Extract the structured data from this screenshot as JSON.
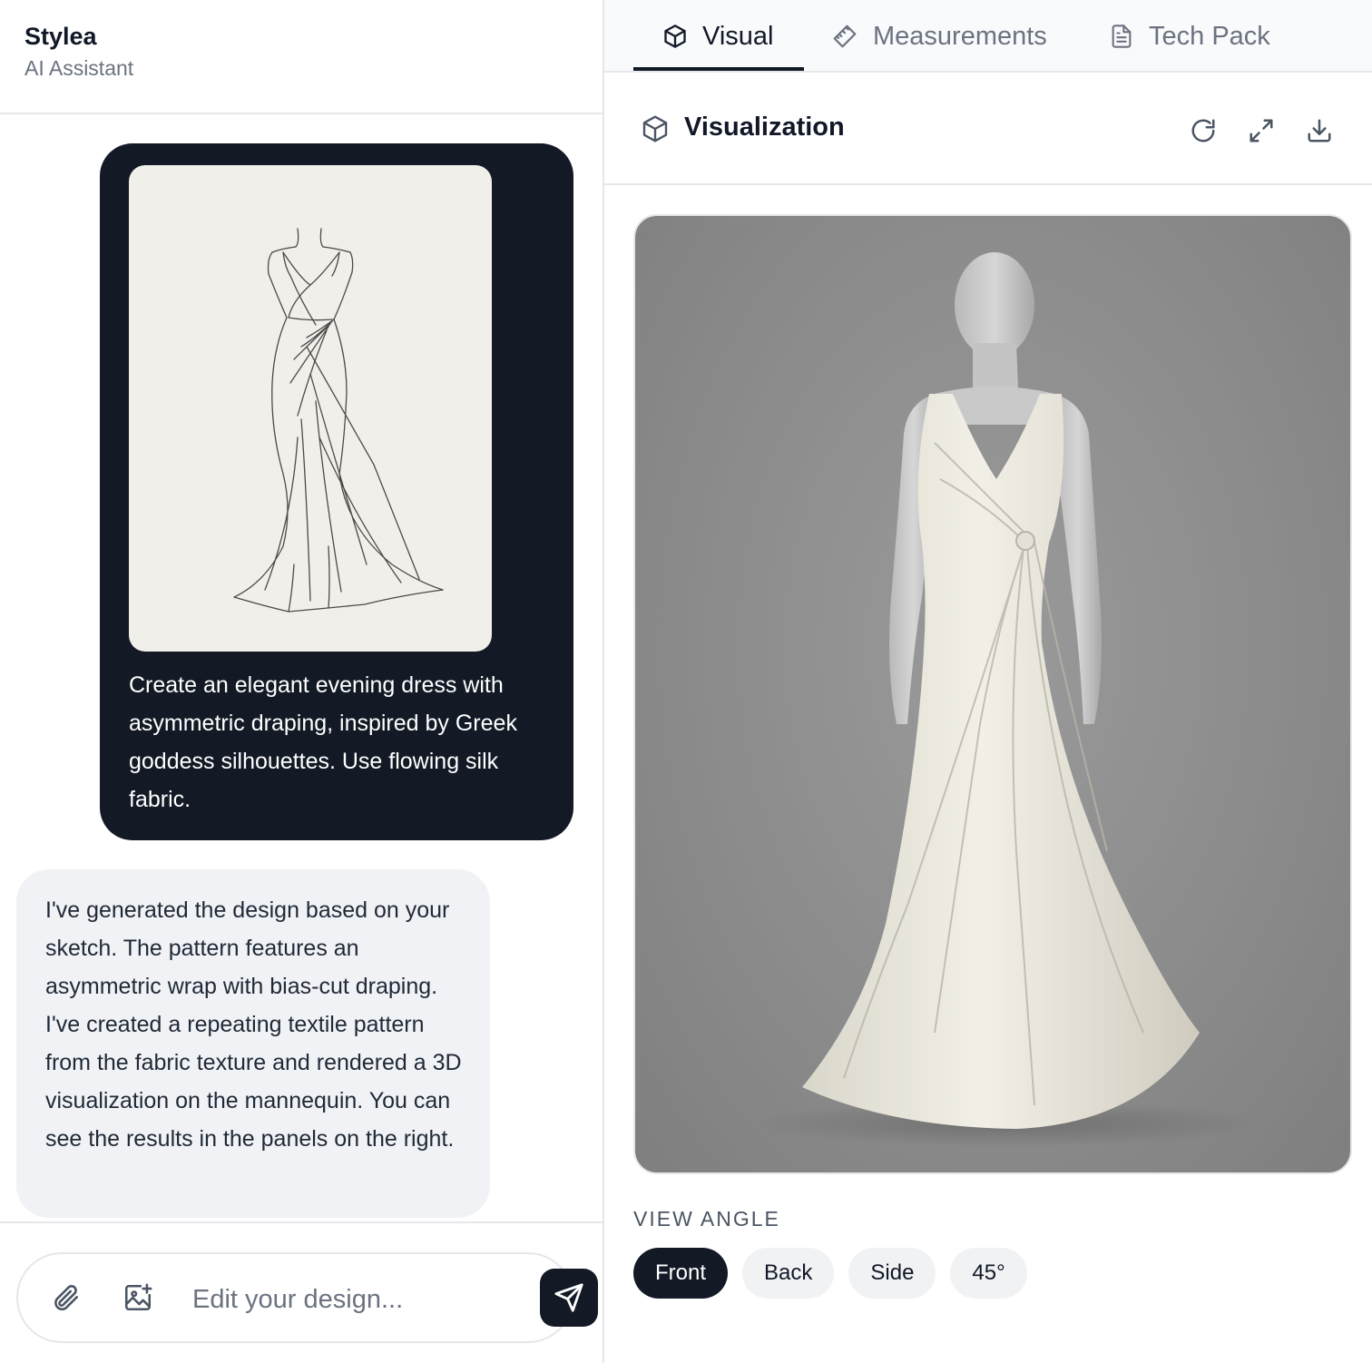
{
  "app": {
    "name": "Stylea",
    "subtitle": "AI Assistant"
  },
  "chat": {
    "user_message": "Create an elegant evening dress with asymmetric draping, inspired by Greek goddess silhouettes. Use flowing silk fabric.",
    "assistant_message": "I've generated the design based on your sketch. The pattern features an asymmetric wrap with bias-cut draping. I've created a repeating textile pattern from the fabric texture and rendered a 3D visualization on the mannequin. You can see the results in the panels on the right.",
    "input": {
      "placeholder": "Edit your design...",
      "value": ""
    }
  },
  "tabs": [
    {
      "label": "Visual",
      "icon": "cube-icon",
      "active": true
    },
    {
      "label": "Measurements",
      "icon": "ruler-icon",
      "active": false
    },
    {
      "label": "Tech Pack",
      "icon": "document-icon",
      "active": false
    }
  ],
  "visualization": {
    "title": "Visualization",
    "tools": [
      "refresh-icon",
      "expand-icon",
      "download-icon"
    ],
    "view_angle_label": "VIEW ANGLE",
    "angles": [
      "Front",
      "Back",
      "Side",
      "45°"
    ],
    "selected_angle": "Front"
  },
  "colors": {
    "dark": "#131a26",
    "muted": "#6b7280",
    "border": "#e5e7eb",
    "bubble": "#f1f2f5"
  }
}
